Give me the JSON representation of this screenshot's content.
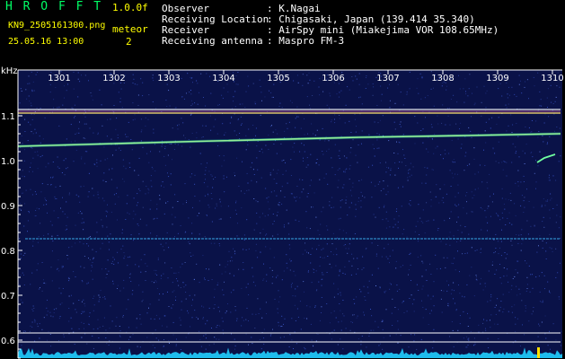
{
  "header": {
    "app_title": "H R O F F T",
    "version": "1.0.0f",
    "file_name": "KN9_2505161300.png",
    "mode_label": "meteor",
    "timestamp": "25.05.16 13:00",
    "count": "2",
    "fields": [
      {
        "label": "Observer",
        "value": ": K.Nagai"
      },
      {
        "label": "Receiving Location",
        "value": ": Chigasaki, Japan (139.414 35.340)"
      },
      {
        "label": "Receiver",
        "value": ": AirSpy mini (Miakejima VOR 108.65MHz)"
      },
      {
        "label": "Receiving antenna",
        "value": ": Maspro FM-3"
      }
    ]
  },
  "spectrogram": {
    "y_unit": "kHz",
    "y_ticks": [
      "1.1",
      "1.0",
      "0.9",
      "0.8",
      "0.7",
      "0.6"
    ],
    "x_ticks": [
      "1301",
      "1302",
      "1303",
      "1304",
      "1305",
      "1306",
      "1307",
      "1308",
      "1309",
      "1310"
    ],
    "background_color": "#0a1248",
    "noise_color": "#3c5ad2",
    "axis_color": "#ffffff",
    "text_color": "#ffffff",
    "highlight_text_color": "#ffff00",
    "header_title_color": "#00ff66"
  }
}
